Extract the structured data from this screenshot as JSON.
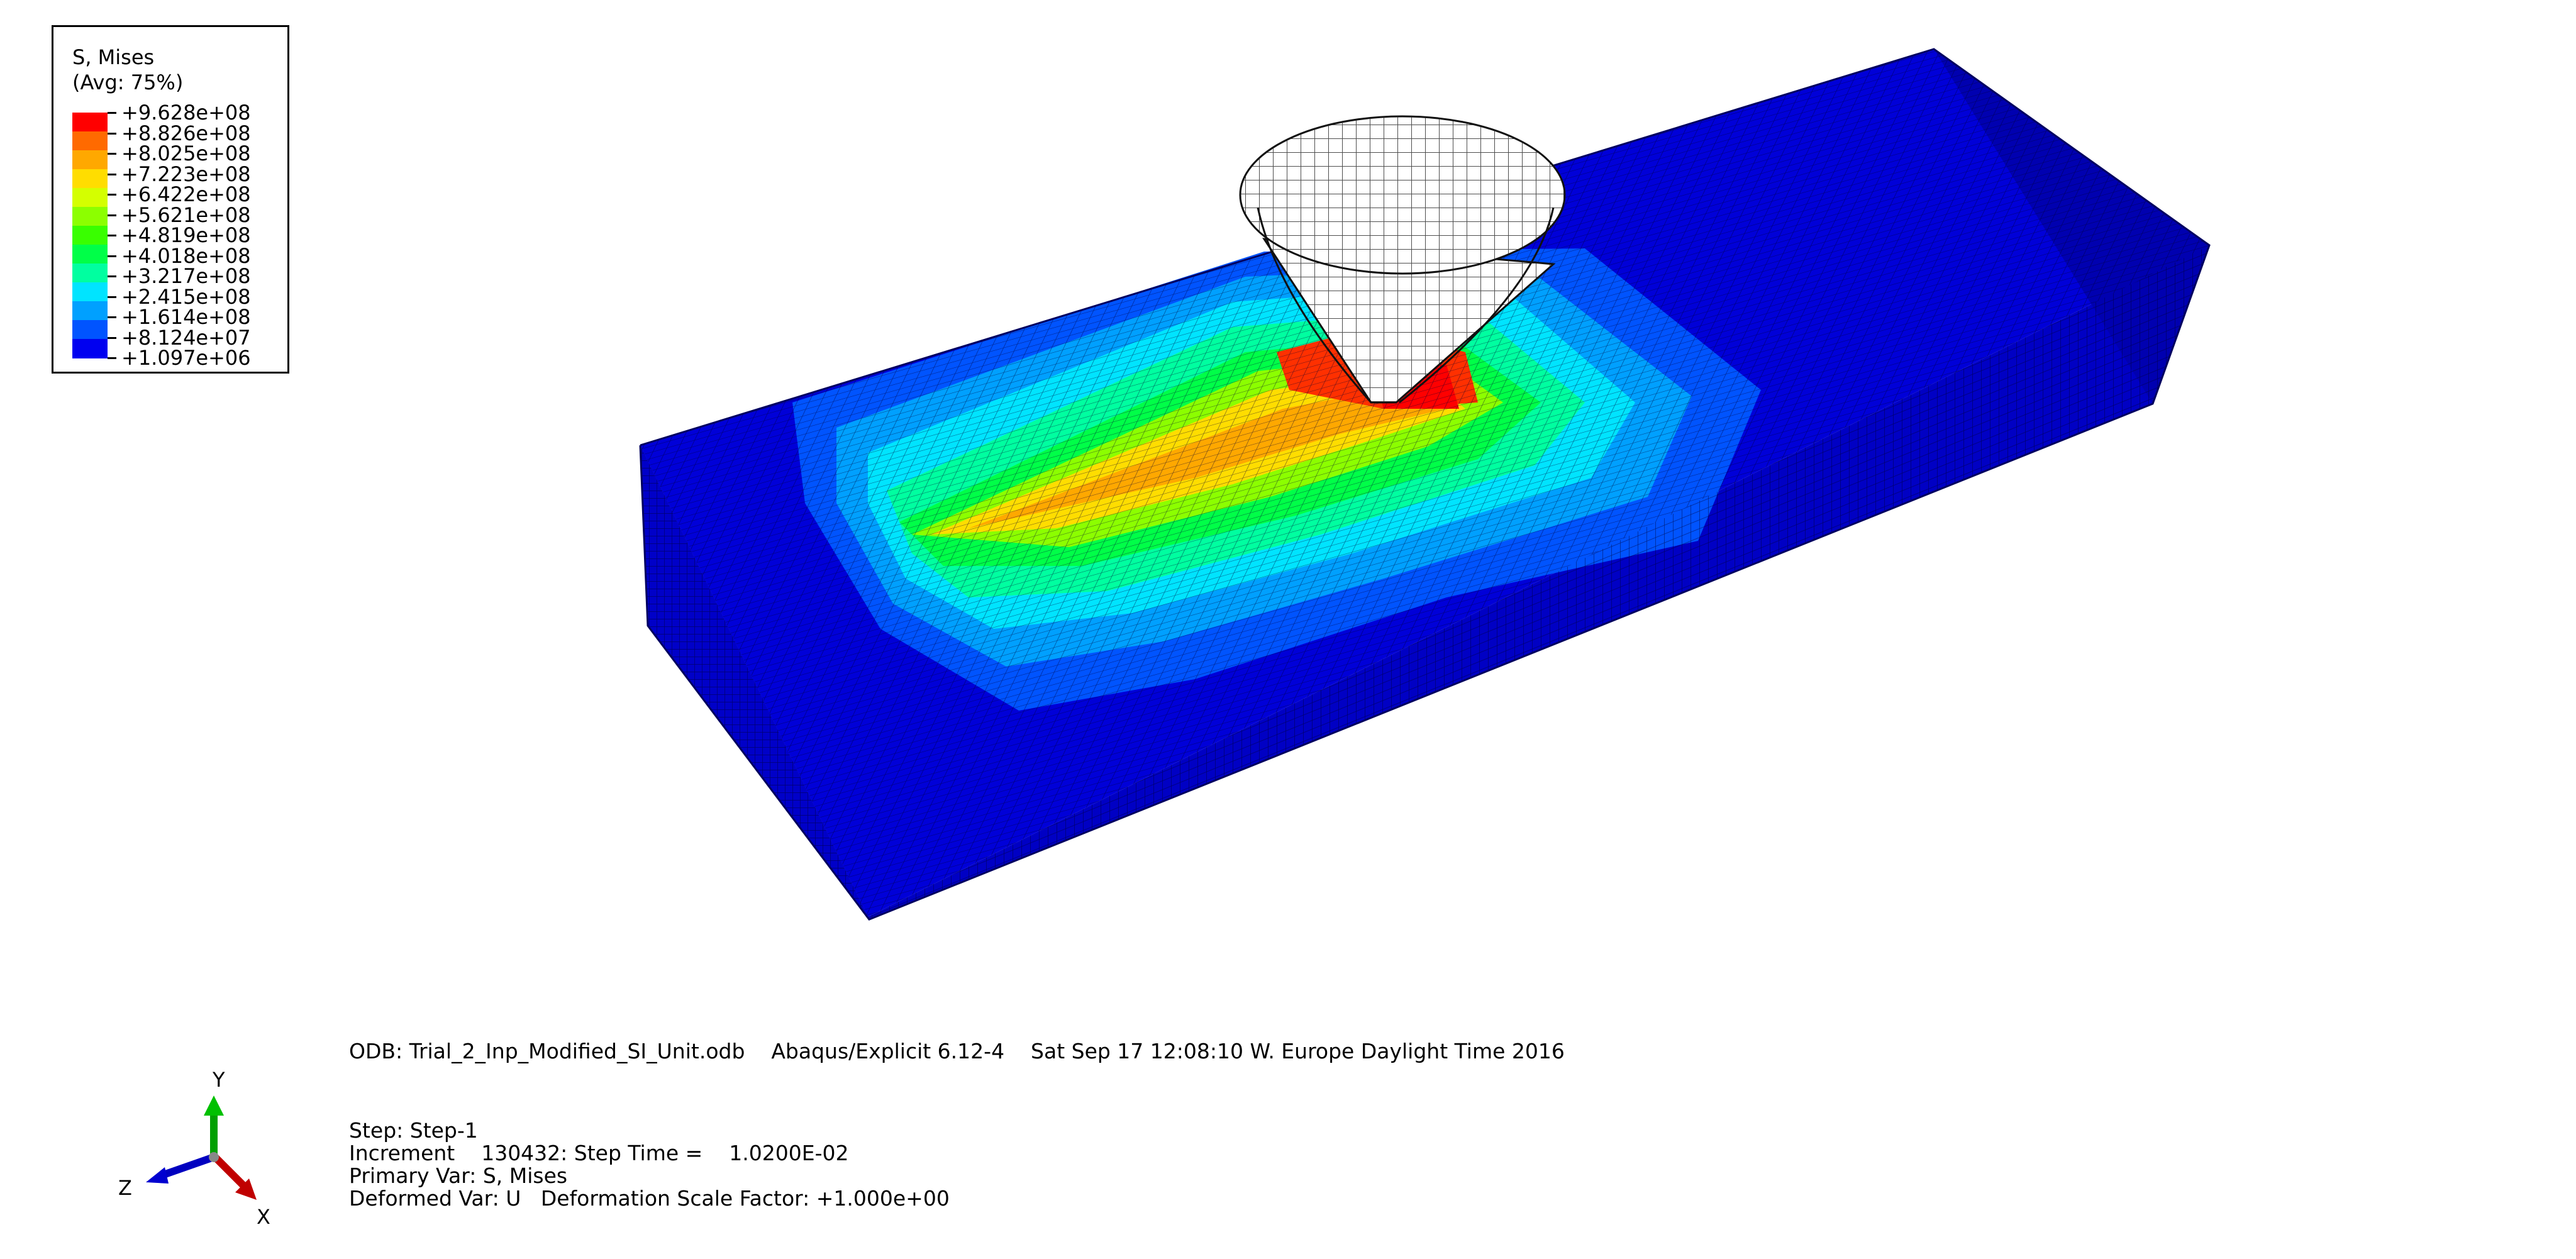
{
  "legend": {
    "title": "S, Mises",
    "subtitle": "(Avg: 75%)",
    "values": [
      "+9.628e+08",
      "+8.826e+08",
      "+8.025e+08",
      "+7.223e+08",
      "+6.422e+08",
      "+5.621e+08",
      "+4.819e+08",
      "+4.018e+08",
      "+3.217e+08",
      "+2.415e+08",
      "+1.614e+08",
      "+8.124e+07",
      "+1.097e+06"
    ],
    "colors": [
      "#ff0000",
      "#ff6a00",
      "#ffa800",
      "#ffdd00",
      "#d4ff00",
      "#8cff00",
      "#39ff00",
      "#00ff48",
      "#00ffa0",
      "#00e4ff",
      "#00a0ff",
      "#0054ff",
      "#0000f0"
    ]
  },
  "info": {
    "odb_line": "ODB: Trial_2_Inp_Modified_SI_Unit.odb    Abaqus/Explicit 6.12-4    Sat Sep 17 12:08:10 W. Europe Daylight Time 2016",
    "step": "Step: Step-1",
    "increment": "Increment    130432: Step Time =    1.0200E-02",
    "primary_var": "Primary Var: S, Mises",
    "deformed_var": "Deformed Var: U   Deformation Scale Factor: +1.000e+00"
  },
  "triad": {
    "y": "Y",
    "z": "Z",
    "x": "X"
  },
  "colors": {
    "block_blue": "#0000d8",
    "block_side": "#0000b8",
    "mesh_line": "#000040"
  }
}
